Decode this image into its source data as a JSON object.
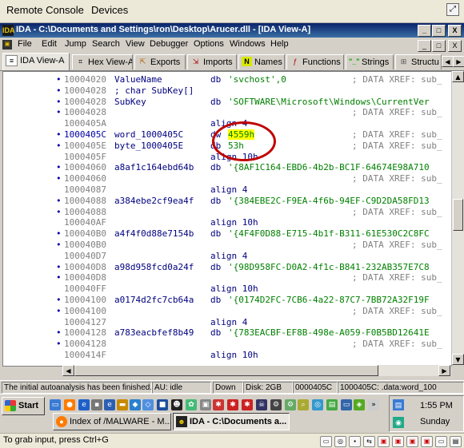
{
  "remote_console": {
    "menus": [
      {
        "label": "Remote Console"
      },
      {
        "label": "Devices"
      }
    ],
    "expand_icon": "expand-icon"
  },
  "window": {
    "title": "IDA - C:\\Documents and Settings\\ron\\Desktop\\Arucer.dll - [IDA View-A]",
    "app_icon": "IDA",
    "controls": [
      "_",
      "□",
      "X"
    ]
  },
  "menu_bar": {
    "items": [
      "File",
      "Edit",
      "Jump",
      "Search",
      "View",
      "Debugger",
      "Options",
      "Windows",
      "Help"
    ],
    "controls": [
      "_",
      "□",
      "X"
    ]
  },
  "tabs": [
    {
      "label": "IDA View-A",
      "icon": "document-icon",
      "active": true
    },
    {
      "label": "Hex View-A",
      "icon": "hex-icon"
    },
    {
      "label": "Exports",
      "icon": "exports-icon"
    },
    {
      "label": "Imports",
      "icon": "imports-icon"
    },
    {
      "label": "Names",
      "icon": "N"
    },
    {
      "label": "Functions",
      "icon": "functions-icon"
    },
    {
      "label": "Strings",
      "icon": "strings-icon"
    },
    {
      "label": "Structu",
      "icon": "structures-icon"
    }
  ],
  "listing": {
    "rows": [
      {
        "addr": "10004020",
        "name": "ValueName",
        "mnem": "db",
        "op": "'svchost',0",
        "xref": "; DATA XREF: sub_",
        "dot": true
      },
      {
        "addr": "10004028",
        "name": "; char SubKey[]",
        "mnem": "",
        "op": "",
        "xref": "",
        "dot": true,
        "comment": true
      },
      {
        "addr": "10004028",
        "name": "SubKey",
        "mnem": "db",
        "op": "'SOFTWARE\\Microsoft\\Windows\\CurrentVer",
        "xref": "",
        "dot": true
      },
      {
        "addr": "10004028",
        "name": "",
        "mnem": "",
        "op": "",
        "xref": "; DATA XREF: sub_",
        "dot": true
      },
      {
        "addr": "1000405A",
        "name": "",
        "mnem": "align 4",
        "op": "",
        "xref": "",
        "dot": false
      },
      {
        "addr": "1000405C",
        "name": "word_1000405C",
        "mnem": "dw",
        "op": "4559h",
        "xref": "; DATA XREF: sub_",
        "dot": true,
        "highlight": true,
        "yellow": true
      },
      {
        "addr": "1000405E",
        "name": "byte_1000405E",
        "mnem": "db",
        "op": "53h",
        "xref": "; DATA XREF: sub_",
        "dot": true
      },
      {
        "addr": "1000405F",
        "name": "",
        "mnem": "align 10h",
        "op": "",
        "xref": "",
        "dot": false
      },
      {
        "addr": "10004060",
        "name": "a8af1c164ebd64b",
        "mnem": "db",
        "op": "'{8AF1C164-EBD6-4b2b-BC1F-64674E98A710",
        "xref": "",
        "dot": true
      },
      {
        "addr": "10004060",
        "name": "",
        "mnem": "",
        "op": "",
        "xref": "; DATA XREF: sub_",
        "dot": true
      },
      {
        "addr": "10004087",
        "name": "",
        "mnem": "align 4",
        "op": "",
        "xref": "",
        "dot": false
      },
      {
        "addr": "10004088",
        "name": "a384ebe2cf9ea4f",
        "mnem": "db",
        "op": "'{384EBE2C-F9EA-4f6b-94EF-C9D2DA58FD13",
        "xref": "",
        "dot": true
      },
      {
        "addr": "10004088",
        "name": "",
        "mnem": "",
        "op": "",
        "xref": "; DATA XREF: sub_",
        "dot": true
      },
      {
        "addr": "100040AF",
        "name": "",
        "mnem": "align 10h",
        "op": "",
        "xref": "",
        "dot": false
      },
      {
        "addr": "100040B0",
        "name": "a4f4f0d88e7154b",
        "mnem": "db",
        "op": "'{4F4F0D88-E715-4b1f-B311-61E530C2C8FC",
        "xref": "",
        "dot": true
      },
      {
        "addr": "100040B0",
        "name": "",
        "mnem": "",
        "op": "",
        "xref": "; DATA XREF: sub_",
        "dot": true
      },
      {
        "addr": "100040D7",
        "name": "",
        "mnem": "align 4",
        "op": "",
        "xref": "",
        "dot": false
      },
      {
        "addr": "100040D8",
        "name": "a98d958fcd0a24f",
        "mnem": "db",
        "op": "'{98D958FC-D0A2-4f1c-B841-232AB357E7C8",
        "xref": "",
        "dot": true
      },
      {
        "addr": "100040D8",
        "name": "",
        "mnem": "",
        "op": "",
        "xref": "; DATA XREF: sub_",
        "dot": true
      },
      {
        "addr": "100040FF",
        "name": "",
        "mnem": "align 10h",
        "op": "",
        "xref": "",
        "dot": false
      },
      {
        "addr": "10004100",
        "name": "a0174d2fc7cb64a",
        "mnem": "db",
        "op": "'{0174D2FC-7CB6-4a22-87C7-7BB72A32F19F",
        "xref": "",
        "dot": true
      },
      {
        "addr": "10004100",
        "name": "",
        "mnem": "",
        "op": "",
        "xref": "; DATA XREF: sub_",
        "dot": true
      },
      {
        "addr": "10004127",
        "name": "",
        "mnem": "align 4",
        "op": "",
        "xref": "",
        "dot": false
      },
      {
        "addr": "10004128",
        "name": "a783eacbfef8b49",
        "mnem": "db",
        "op": "'{783EACBF-EF8B-498e-A059-F0B5BD12641E",
        "xref": "",
        "dot": true
      },
      {
        "addr": "10004128",
        "name": "",
        "mnem": "",
        "op": "",
        "xref": "; DATA XREF: sub_",
        "dot": true
      },
      {
        "addr": "1000414F",
        "name": "",
        "mnem": "align 10h",
        "op": "",
        "xref": "",
        "dot": false
      }
    ]
  },
  "status_bar": {
    "message": "The initial autoanalysis has been finished.",
    "au": "AU:  idle",
    "dir": "Down",
    "disk": "Disk: 2GB",
    "offset": "0000405C",
    "location": "1000405C: .data:word_100"
  },
  "taskbar": {
    "start_label": "Start",
    "tasks": [
      {
        "label": "Index of /MALWARE - M...",
        "icon": "firefox-icon"
      },
      {
        "label": "IDA - C:\\Documents a...",
        "icon": "ida-icon",
        "active": true
      }
    ],
    "time": "1:55 PM",
    "day": "Sunday"
  },
  "bottom_bar": {
    "hint": "To grab input, press Ctrl+G"
  }
}
